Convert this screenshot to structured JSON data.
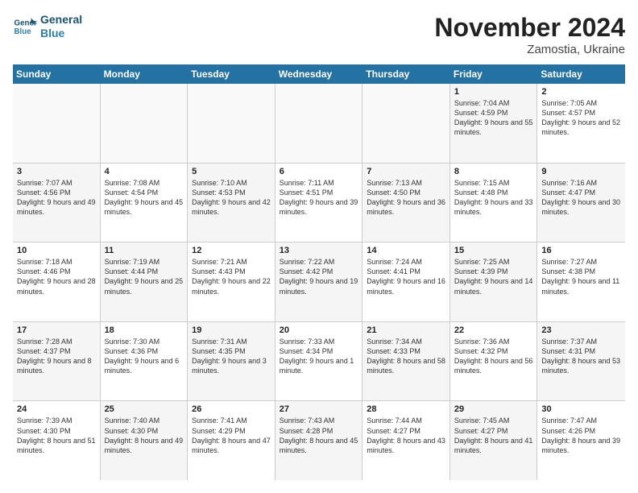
{
  "logo": {
    "line1": "General",
    "line2": "Blue"
  },
  "title": "November 2024",
  "subtitle": "Zamostia, Ukraine",
  "days": [
    "Sunday",
    "Monday",
    "Tuesday",
    "Wednesday",
    "Thursday",
    "Friday",
    "Saturday"
  ],
  "rows": [
    [
      {
        "day": "",
        "info": ""
      },
      {
        "day": "",
        "info": ""
      },
      {
        "day": "",
        "info": ""
      },
      {
        "day": "",
        "info": ""
      },
      {
        "day": "",
        "info": ""
      },
      {
        "day": "1",
        "info": "Sunrise: 7:04 AM\nSunset: 4:59 PM\nDaylight: 9 hours and 55 minutes."
      },
      {
        "day": "2",
        "info": "Sunrise: 7:05 AM\nSunset: 4:57 PM\nDaylight: 9 hours and 52 minutes."
      }
    ],
    [
      {
        "day": "3",
        "info": "Sunrise: 7:07 AM\nSunset: 4:56 PM\nDaylight: 9 hours and 49 minutes."
      },
      {
        "day": "4",
        "info": "Sunrise: 7:08 AM\nSunset: 4:54 PM\nDaylight: 9 hours and 45 minutes."
      },
      {
        "day": "5",
        "info": "Sunrise: 7:10 AM\nSunset: 4:53 PM\nDaylight: 9 hours and 42 minutes."
      },
      {
        "day": "6",
        "info": "Sunrise: 7:11 AM\nSunset: 4:51 PM\nDaylight: 9 hours and 39 minutes."
      },
      {
        "day": "7",
        "info": "Sunrise: 7:13 AM\nSunset: 4:50 PM\nDaylight: 9 hours and 36 minutes."
      },
      {
        "day": "8",
        "info": "Sunrise: 7:15 AM\nSunset: 4:48 PM\nDaylight: 9 hours and 33 minutes."
      },
      {
        "day": "9",
        "info": "Sunrise: 7:16 AM\nSunset: 4:47 PM\nDaylight: 9 hours and 30 minutes."
      }
    ],
    [
      {
        "day": "10",
        "info": "Sunrise: 7:18 AM\nSunset: 4:46 PM\nDaylight: 9 hours and 28 minutes."
      },
      {
        "day": "11",
        "info": "Sunrise: 7:19 AM\nSunset: 4:44 PM\nDaylight: 9 hours and 25 minutes."
      },
      {
        "day": "12",
        "info": "Sunrise: 7:21 AM\nSunset: 4:43 PM\nDaylight: 9 hours and 22 minutes."
      },
      {
        "day": "13",
        "info": "Sunrise: 7:22 AM\nSunset: 4:42 PM\nDaylight: 9 hours and 19 minutes."
      },
      {
        "day": "14",
        "info": "Sunrise: 7:24 AM\nSunset: 4:41 PM\nDaylight: 9 hours and 16 minutes."
      },
      {
        "day": "15",
        "info": "Sunrise: 7:25 AM\nSunset: 4:39 PM\nDaylight: 9 hours and 14 minutes."
      },
      {
        "day": "16",
        "info": "Sunrise: 7:27 AM\nSunset: 4:38 PM\nDaylight: 9 hours and 11 minutes."
      }
    ],
    [
      {
        "day": "17",
        "info": "Sunrise: 7:28 AM\nSunset: 4:37 PM\nDaylight: 9 hours and 8 minutes."
      },
      {
        "day": "18",
        "info": "Sunrise: 7:30 AM\nSunset: 4:36 PM\nDaylight: 9 hours and 6 minutes."
      },
      {
        "day": "19",
        "info": "Sunrise: 7:31 AM\nSunset: 4:35 PM\nDaylight: 9 hours and 3 minutes."
      },
      {
        "day": "20",
        "info": "Sunrise: 7:33 AM\nSunset: 4:34 PM\nDaylight: 9 hours and 1 minute."
      },
      {
        "day": "21",
        "info": "Sunrise: 7:34 AM\nSunset: 4:33 PM\nDaylight: 8 hours and 58 minutes."
      },
      {
        "day": "22",
        "info": "Sunrise: 7:36 AM\nSunset: 4:32 PM\nDaylight: 8 hours and 56 minutes."
      },
      {
        "day": "23",
        "info": "Sunrise: 7:37 AM\nSunset: 4:31 PM\nDaylight: 8 hours and 53 minutes."
      }
    ],
    [
      {
        "day": "24",
        "info": "Sunrise: 7:39 AM\nSunset: 4:30 PM\nDaylight: 8 hours and 51 minutes."
      },
      {
        "day": "25",
        "info": "Sunrise: 7:40 AM\nSunset: 4:30 PM\nDaylight: 8 hours and 49 minutes."
      },
      {
        "day": "26",
        "info": "Sunrise: 7:41 AM\nSunset: 4:29 PM\nDaylight: 8 hours and 47 minutes."
      },
      {
        "day": "27",
        "info": "Sunrise: 7:43 AM\nSunset: 4:28 PM\nDaylight: 8 hours and 45 minutes."
      },
      {
        "day": "28",
        "info": "Sunrise: 7:44 AM\nSunset: 4:27 PM\nDaylight: 8 hours and 43 minutes."
      },
      {
        "day": "29",
        "info": "Sunrise: 7:45 AM\nSunset: 4:27 PM\nDaylight: 8 hours and 41 minutes."
      },
      {
        "day": "30",
        "info": "Sunrise: 7:47 AM\nSunset: 4:26 PM\nDaylight: 8 hours and 39 minutes."
      }
    ]
  ]
}
